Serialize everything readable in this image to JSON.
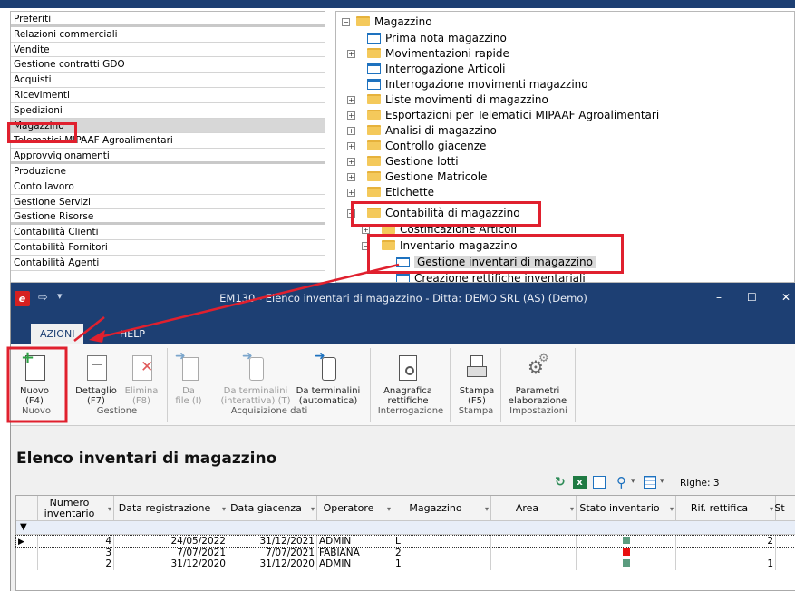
{
  "left_menu": {
    "items": [
      {
        "label": "Preferiti",
        "sep": true
      },
      {
        "label": "Relazioni commerciali"
      },
      {
        "label": "Vendite"
      },
      {
        "label": "Gestione contratti GDO"
      },
      {
        "label": "Acquisti"
      },
      {
        "label": "Ricevimenti"
      },
      {
        "label": "Spedizioni"
      },
      {
        "label": "Magazzino",
        "selected": true
      },
      {
        "label": "Telematici MIPAAF Agroalimentari"
      },
      {
        "label": "Approvvigionamenti",
        "sep": true
      },
      {
        "label": "Produzione"
      },
      {
        "label": "Conto lavoro"
      },
      {
        "label": "Gestione Servizi"
      },
      {
        "label": "Gestione Risorse",
        "sep": true
      },
      {
        "label": "Contabilità Clienti"
      },
      {
        "label": "Contabilità Fornitori"
      },
      {
        "label": "Contabilità Agenti"
      }
    ]
  },
  "tree": {
    "root": "Magazzino",
    "items": [
      "Prima nota magazzino",
      "Movimentazioni rapide",
      "Interrogazione Articoli",
      "Interrogazione movimenti magazzino",
      "Liste movimenti di magazzino",
      "Esportazioni per Telematici MIPAAF Agroalimentari",
      "Analisi di magazzino",
      "Controllo giacenze",
      "Gestione lotti",
      "Gestione Matricole",
      "Etichette",
      "Contabilità di magazzino",
      "Costificazione Articoli",
      "Inventario magazzino",
      "Gestione inventari di magazzino",
      "Creazione rettifiche inventariali"
    ]
  },
  "window": {
    "title": "EM130 - Elenco inventari di magazzino - Ditta: DEMO SRL (AS)  (Demo)",
    "min_icon": "–",
    "max_icon": "☐",
    "close_icon": "✕"
  },
  "ribbon_tabs": {
    "azioni": "AZIONI",
    "help": "HELP"
  },
  "ribbon": {
    "nuovo": [
      "Nuovo",
      "(F4)"
    ],
    "dettaglio": [
      "Dettaglio",
      "(F7)"
    ],
    "elimina": [
      "Elimina",
      "(F8)"
    ],
    "da_file": [
      "Da",
      "file (I)"
    ],
    "da_term_int": [
      "Da terminalini",
      "(interattiva) (T)"
    ],
    "da_term_auto": [
      "Da terminalini",
      "(automatica)"
    ],
    "anagrafica": [
      "Anagrafica",
      "rettifiche"
    ],
    "stampa": [
      "Stampa",
      "(F5)"
    ],
    "parametri": [
      "Parametri",
      "elaborazione"
    ],
    "groups": {
      "nuovo": "Nuovo",
      "gestione": "Gestione",
      "acquisizione": "Acquisizione dati",
      "interrogazione": "Interrogazione",
      "stampa": "Stampa",
      "impostazioni": "Impostazioni"
    }
  },
  "page": {
    "title": "Elenco inventari di magazzino"
  },
  "grid_toolbar": {
    "righe": "Righe: 3"
  },
  "grid": {
    "columns": [
      "Numero inventario",
      "Data registrazione",
      "Data giacenza",
      "Operatore",
      "Magazzino",
      "Area",
      "Stato inventario",
      "Rif. rettifica",
      "St"
    ],
    "rows": [
      {
        "numero": "4",
        "data_reg": "24/05/2022",
        "data_giac": "31/12/2021",
        "operatore": "ADMIN",
        "magazzino": "L",
        "area": "",
        "stato_color": "#5b9c7f",
        "rif": "2"
      },
      {
        "numero": "3",
        "data_reg": "7/07/2021",
        "data_giac": "7/07/2021",
        "operatore": "FABIANA",
        "magazzino": "2",
        "area": "",
        "stato_color": "#e81010",
        "rif": ""
      },
      {
        "numero": "2",
        "data_reg": "31/12/2020",
        "data_giac": "31/12/2020",
        "operatore": "ADMIN",
        "magazzino": "1",
        "area": "",
        "stato_color": "#5b9c7f",
        "rif": "1"
      }
    ]
  }
}
